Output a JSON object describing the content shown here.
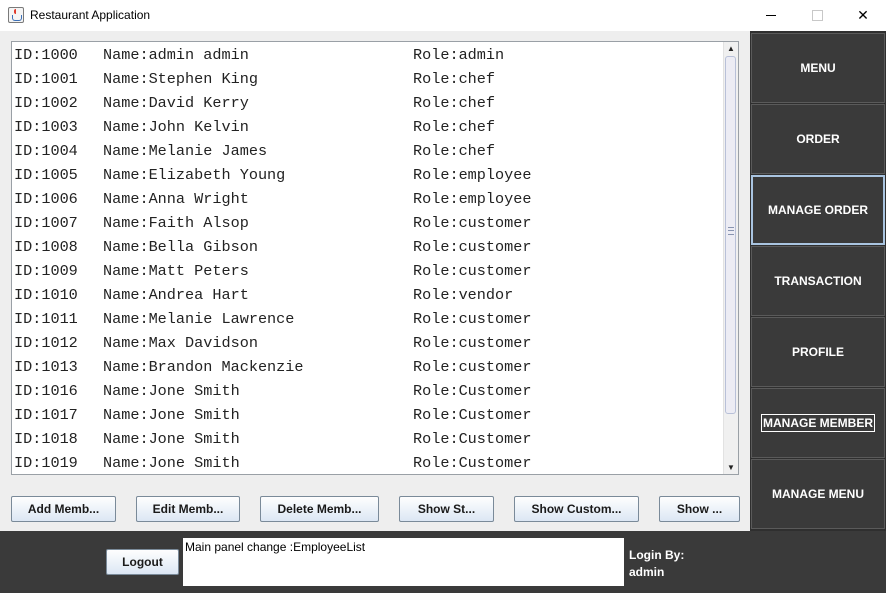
{
  "window": {
    "title": "Restaurant Application"
  },
  "list": {
    "rows": [
      {
        "id": "ID:1000",
        "name": "Name:admin admin",
        "role": "Role:admin"
      },
      {
        "id": "ID:1001",
        "name": "Name:Stephen King",
        "role": "Role:chef"
      },
      {
        "id": "ID:1002",
        "name": "Name:David Kerry",
        "role": "Role:chef"
      },
      {
        "id": "ID:1003",
        "name": "Name:John Kelvin",
        "role": "Role:chef"
      },
      {
        "id": "ID:1004",
        "name": "Name:Melanie James",
        "role": "Role:chef"
      },
      {
        "id": "ID:1005",
        "name": "Name:Elizabeth Young",
        "role": "Role:employee"
      },
      {
        "id": "ID:1006",
        "name": "Name:Anna Wright",
        "role": "Role:employee"
      },
      {
        "id": "ID:1007",
        "name": "Name:Faith Alsop",
        "role": "Role:customer"
      },
      {
        "id": "ID:1008",
        "name": "Name:Bella Gibson",
        "role": "Role:customer"
      },
      {
        "id": "ID:1009",
        "name": "Name:Matt Peters",
        "role": "Role:customer"
      },
      {
        "id": "ID:1010",
        "name": "Name:Andrea Hart",
        "role": "Role:vendor"
      },
      {
        "id": "ID:1011",
        "name": "Name:Melanie Lawrence",
        "role": "Role:customer"
      },
      {
        "id": "ID:1012",
        "name": "Name:Max Davidson",
        "role": "Role:customer"
      },
      {
        "id": "ID:1013",
        "name": "Name:Brandon Mackenzie",
        "role": "Role:customer"
      },
      {
        "id": "ID:1016",
        "name": "Name:Jone Smith",
        "role": "Role:Customer"
      },
      {
        "id": "ID:1017",
        "name": "Name:Jone Smith",
        "role": "Role:Customer"
      },
      {
        "id": "ID:1018",
        "name": "Name:Jone Smith",
        "role": "Role:Customer"
      },
      {
        "id": "ID:1019",
        "name": "Name:Jone Smith",
        "role": "Role:Customer"
      }
    ]
  },
  "actions": {
    "add": "Add Memb...",
    "edit": "Edit Memb...",
    "delete": "Delete Memb...",
    "show_staff": "Show St...",
    "show_customers": "Show Custom...",
    "show_other": "Show ..."
  },
  "sidebar": {
    "items": [
      {
        "label": "MENU"
      },
      {
        "label": "ORDER"
      },
      {
        "label": "MANAGE ORDER"
      },
      {
        "label": "TRANSACTION"
      },
      {
        "label": "PROFILE"
      },
      {
        "label": "MANAGE MEMBER"
      },
      {
        "label": "MANAGE MENU"
      }
    ]
  },
  "footer": {
    "logout_label": "Logout",
    "status_text": "Main panel change :EmployeeList",
    "login_label": "Login By:",
    "login_user": "admin"
  }
}
